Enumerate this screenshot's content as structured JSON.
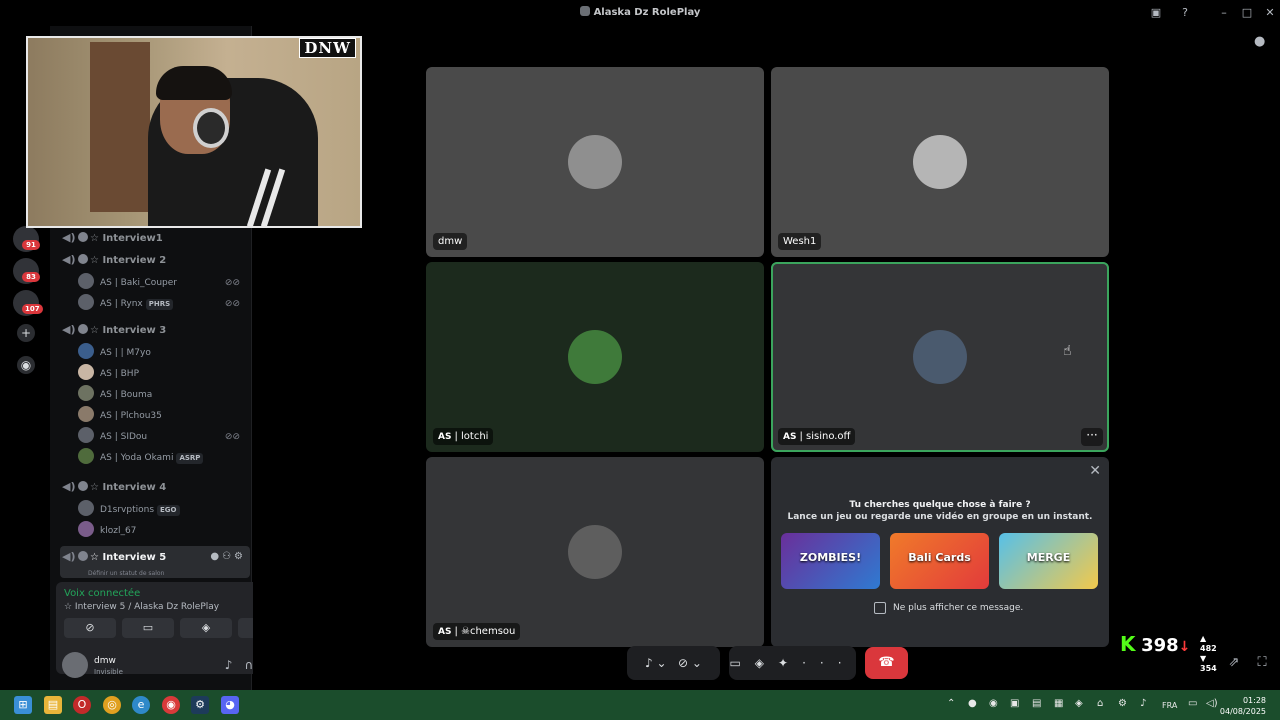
{
  "window": {
    "title": "Alaska Dz RolePlay"
  },
  "rail": {
    "badges": [
      "91",
      "83",
      "107"
    ]
  },
  "channels": [
    {
      "id": "interview1",
      "label": "☆ Interview1",
      "users": []
    },
    {
      "id": "interview2",
      "label": "☆ Interview 2",
      "users": [
        {
          "name": "AS  | Baki_Couper",
          "muted": true,
          "tag": ""
        },
        {
          "name": "AS  | Rynx",
          "muted": true,
          "tag": "PHRS"
        }
      ]
    },
    {
      "id": "interview3",
      "label": "☆ Interview 3",
      "users": [
        {
          "name": "AS  | | M7yo",
          "muted": false,
          "tag": ""
        },
        {
          "name": "AS  | BHP",
          "muted": false,
          "tag": ""
        },
        {
          "name": "AS  | Bouma",
          "muted": false,
          "tag": ""
        },
        {
          "name": "AS  | Plchou35",
          "muted": false,
          "tag": ""
        },
        {
          "name": "AS  | SIDou",
          "muted": true,
          "tag": ""
        },
        {
          "name": "AS  | Yoda Okami",
          "muted": false,
          "tag": "ASRP"
        }
      ]
    },
    {
      "id": "interview4",
      "label": "☆ Interview 4",
      "users": [
        {
          "name": "D1srvptions",
          "muted": false,
          "tag": "EGO"
        },
        {
          "name": "klozl_67",
          "muted": false,
          "tag": ""
        }
      ]
    },
    {
      "id": "interview5",
      "label": "☆ Interview 5",
      "status": "Définir un statut de salon",
      "users": []
    }
  ],
  "voice_panel": {
    "status": "Voix connectée",
    "location": "☆ Interview 5 / Alaska Dz RolePlay"
  },
  "self": {
    "name": "dmw",
    "status": "Invisible"
  },
  "webcam": {
    "logo": "DNW"
  },
  "tiles": [
    {
      "name": "dmw",
      "prefix": ""
    },
    {
      "name": "Wesh1",
      "prefix": ""
    },
    {
      "name": "| lotchi",
      "prefix": "AS"
    },
    {
      "name": "| sisino.off",
      "prefix": "AS"
    },
    {
      "name": "| ☠chemsou",
      "prefix": "AS"
    }
  ],
  "activity": {
    "line1": "Tu cherches quelque chose à faire ?",
    "line2": "Lance un jeu ou regarde une vidéo en groupe en un instant.",
    "games": [
      "ZOMBIES!",
      "Bali Cards",
      "MERGE"
    ],
    "checkbox_label": "Ne plus afficher ce message."
  },
  "overlay": {
    "count": "398",
    "up": "482",
    "down": "354"
  },
  "taskbar": {
    "lang": "FRA",
    "time": "01:28",
    "date": "04/08/2025"
  },
  "colors": {
    "speaking": "#3ba55d",
    "hangup": "#da373c",
    "taskbar": "#1b4d2c",
    "kick": "#53fc18"
  }
}
